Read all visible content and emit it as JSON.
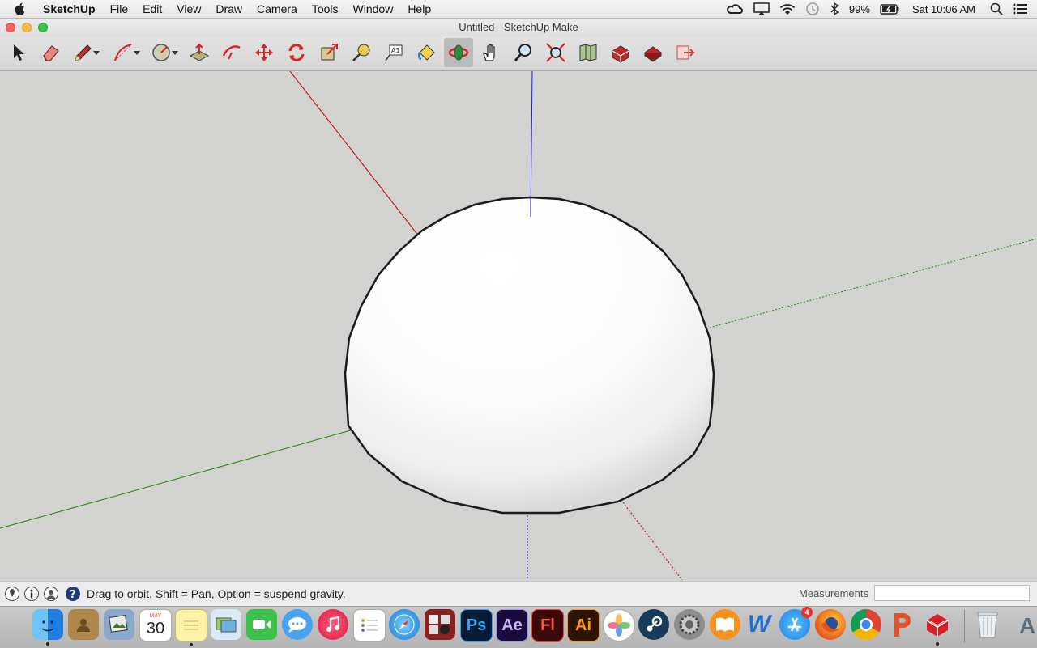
{
  "menubar": {
    "app_name": "SketchUp",
    "items": [
      "File",
      "Edit",
      "View",
      "Draw",
      "Camera",
      "Tools",
      "Window",
      "Help"
    ],
    "battery": "99%",
    "clock": "Sat 10:06 AM"
  },
  "window": {
    "title": "Untitled - SketchUp Make"
  },
  "toolbar": {
    "tools": [
      "select-tool",
      "eraser-tool",
      "pencil-line-tool",
      "arc-tool",
      "circle-shapes-tool",
      "push-pull-tool",
      "offset-tool",
      "move-tool",
      "rotate-tool",
      "scale-tool",
      "tape-measure-tool",
      "text-tool",
      "paint-bucket-tool",
      "orbit-tool",
      "pan-tool",
      "zoom-tool",
      "zoom-extents-tool",
      "previous-view-tool",
      "3d-warehouse-tool",
      "extension-warehouse-tool",
      "send-to-layout-tool"
    ],
    "active": "orbit-tool"
  },
  "status": {
    "message": "Drag to orbit. Shift = Pan, Option = suspend gravity.",
    "measurements_label": "Measurements",
    "measurements_value": ""
  },
  "dock": {
    "apps": [
      "Finder",
      "Contacts",
      "Preview",
      "Calendar",
      "Notes",
      "iPhoto",
      "FaceTime",
      "Messages",
      "iTunes",
      "Reminders",
      "Safari",
      "Photo Booth",
      "Photoshop",
      "After Effects",
      "Flash",
      "Illustrator",
      "Photos",
      "Steam",
      "System Preferences",
      "iBooks",
      "Word",
      "App Store",
      "Firefox",
      "Chrome",
      "PowerPoint",
      "SketchUp",
      "Trash"
    ],
    "calendar_month": "MAY",
    "calendar_day": "30",
    "photoshop_label": "Ps",
    "aftereffects_label": "Ae",
    "flash_label": "Fl",
    "illustrator_label": "Ai",
    "word_label": "W",
    "appstore_badge": "4",
    "edge_text": "AL"
  },
  "colors": {
    "x_axis": "#c00000",
    "y_axis": "#1e8a00",
    "z_axis": "#1a1ad8",
    "viewport_bg": "#d2d2d0",
    "close": "#fc605c",
    "minimize": "#fdbc40",
    "maximize": "#34c84a"
  }
}
